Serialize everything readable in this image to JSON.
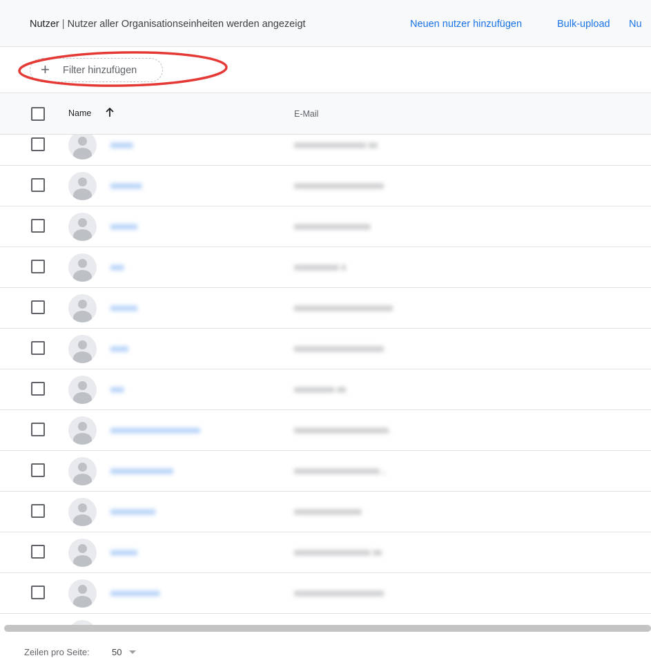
{
  "header": {
    "title": "Nutzer",
    "separator": "|",
    "subtitle": "Nutzer aller Organisationseinheiten werden angezeigt",
    "actions": [
      "Neuen nutzer hinzufügen",
      "Bulk-upload",
      "Nu"
    ]
  },
  "filter": {
    "label": "Filter hinzufügen",
    "icon": "plus-icon"
  },
  "annotation": {
    "color": "#e53935"
  },
  "table": {
    "columns": [
      "Name",
      "E-Mail"
    ],
    "sort_icon": "arrow-up-icon",
    "avatar_icon": "person-icon",
    "rows": [
      {
        "name": "xxxxx",
        "email": "xxxxxxxxxxxxxxxx xx"
      },
      {
        "name": "xxxxxxx",
        "email": "xxxxxxxxxxxxxxxxxxxx"
      },
      {
        "name": "xxxxxx",
        "email": "xxxxxxxxxxxxxxxxx"
      },
      {
        "name": "xxx",
        "email": "xxxxxxxxxx x"
      },
      {
        "name": "xxxxxx",
        "email": "xxxxxxxxxxxxxxxxxxxxxx"
      },
      {
        "name": "xxxx",
        "email": "xxxxxxxxxxxxxxxxxxxx"
      },
      {
        "name": "xxx",
        "email": "xxxxxxxxx xx"
      },
      {
        "name": "xxxxxxxxxxxxxxxxxxxx",
        "email": "xxxxxxxxxxxxxxxxxxxxx."
      },
      {
        "name": "xxxxxxxxxxxxxx",
        "email": "xxxxxxxxxxxxxxxxxxx..."
      },
      {
        "name": "xxxxxxxxxx",
        "email": "xxxxxxxxxxxxxxx"
      },
      {
        "name": "xxxxxx",
        "email": "xxxxxxxxxxxxxxxxx xx"
      },
      {
        "name": "xxxxxxxxxxx",
        "email": "xxxxxxxxxxxxxxxxxxxx"
      },
      {
        "name": "",
        "email": ""
      }
    ]
  },
  "footer": {
    "rows_per_page_label": "Zeilen pro Seite:",
    "rows_per_page_value": "50"
  },
  "colors": {
    "link": "#1a73e8",
    "header_bg": "#f8f9fa",
    "annotation": "#e53935"
  }
}
